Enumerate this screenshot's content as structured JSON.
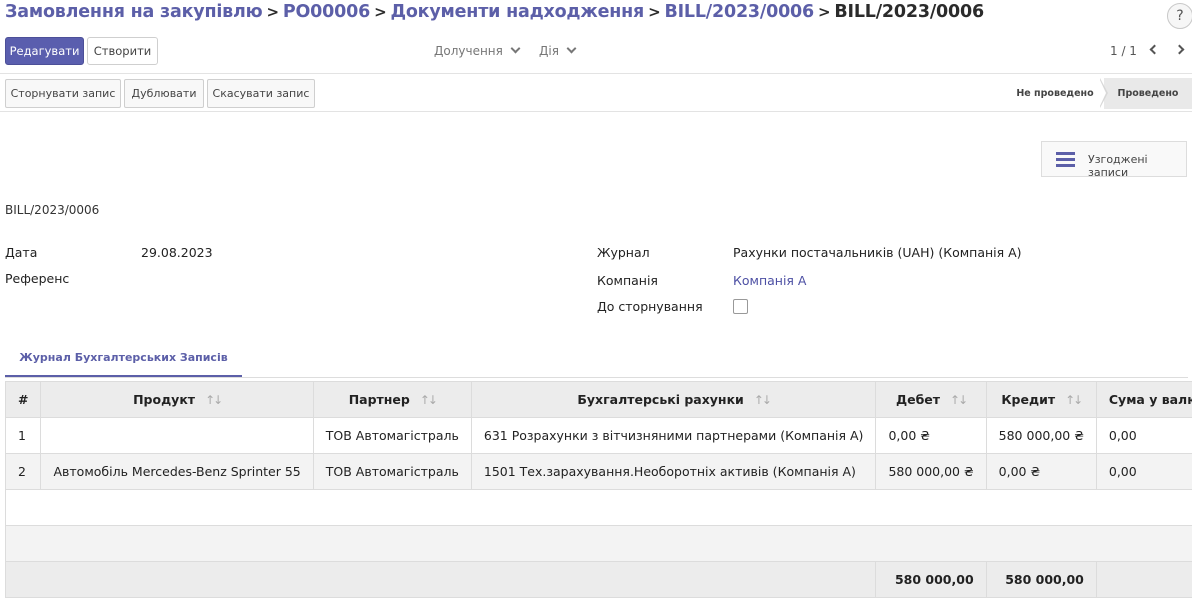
{
  "breadcrumb": [
    "Замовлення на закупівлю",
    "PO00006",
    "Документи надходження",
    "BILL/2023/0006",
    "BILL/2023/0006"
  ],
  "help_label": "?",
  "toolbar": {
    "edit_label": "Редагувати",
    "create_label": "Створити",
    "attachments_label": "Долучення",
    "action_label": "Дія",
    "pager": "1 / 1"
  },
  "statusbar": {
    "reverse_label": "Сторнувати запис",
    "duplicate_label": "Дублювати",
    "cancel_label": "Скасувати запис",
    "stages": [
      "Не проведено",
      "Проведено"
    ],
    "active_stage": "Проведено"
  },
  "smart_button": {
    "label": "Узгоджені записи",
    "icon": "list-icon"
  },
  "record_name": "BILL/2023/0006",
  "fields": {
    "date_label": "Дата",
    "date_value": "29.08.2023",
    "ref_label": "Референс",
    "ref_value": "",
    "journal_label": "Журнал",
    "journal_value": "Рахунки постачальників (UAH) (Компанія А)",
    "company_label": "Компанія",
    "company_value": "Компанія А",
    "to_reverse_label": "До сторнування",
    "to_reverse_checked": false
  },
  "tab_label": "Журнал Бухгалтерських Записів",
  "table": {
    "headers": [
      "#",
      "Продукт",
      "Партнер",
      "Бухгалтерські рахунки",
      "Дебет",
      "Кредит",
      "Сума у валюті"
    ],
    "sort_icon": "sort-arrows-icon",
    "rows": [
      {
        "num": "1",
        "product": "",
        "partner": "ТОВ Автомагістраль",
        "account": "631 Розрахунки з вітчизняними партнерами (Компанія А)",
        "debit": "0,00 ₴",
        "credit": "580 000,00 ₴",
        "amount_currency": "0,00"
      },
      {
        "num": "2",
        "product": "Автомобіль Mercedes-Benz Sprinter 55",
        "partner": "ТОВ Автомагістраль",
        "account": "1501 Тех.зарахування.Необоротніх активів (Компанія А)",
        "debit": "580 000,00 ₴",
        "credit": "0,00 ₴",
        "amount_currency": "0,00"
      }
    ],
    "totals": {
      "debit": "580 000,00",
      "credit": "580 000,00"
    }
  },
  "colors": {
    "accent": "#5c5fa8",
    "primary_button": "#5a5eae"
  }
}
